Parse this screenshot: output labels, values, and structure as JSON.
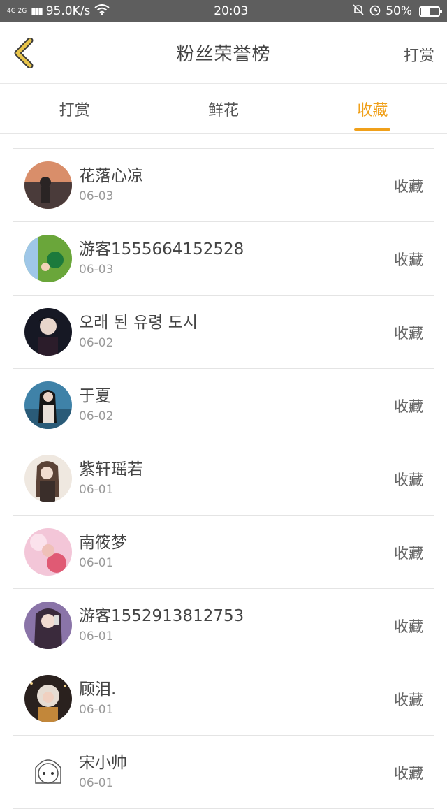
{
  "status_bar": {
    "network": "4G 2G",
    "speed": "95.0K/s",
    "time": "20:03",
    "battery": "50%",
    "battery_level": 0.5
  },
  "header": {
    "title": "粉丝荣誉榜",
    "right_label": "打赏"
  },
  "tabs": [
    {
      "label": "打赏"
    },
    {
      "label": "鲜花"
    },
    {
      "label": "收藏"
    }
  ],
  "active_tab": "收藏",
  "rows": [
    {
      "name": "花落心凉",
      "date": "06-03",
      "action": "收藏"
    },
    {
      "name": "游客15556641​52528",
      "date": "06-03",
      "action": "收藏"
    },
    {
      "name": "오래 된 유령 도시",
      "date": "06-02",
      "action": "收藏"
    },
    {
      "name": "于夏",
      "date": "06-02",
      "action": "收藏"
    },
    {
      "name": "紫轩瑶若",
      "date": "06-01",
      "action": "收藏"
    },
    {
      "name": "南筱梦",
      "date": "06-01",
      "action": "收藏"
    },
    {
      "name": "游客15529138127​53",
      "date": "06-01",
      "action": "收藏"
    },
    {
      "name": "顾泪.",
      "date": "06-01",
      "action": "收藏"
    },
    {
      "name": "宋小帅",
      "date": "06-01",
      "action": "收藏"
    }
  ],
  "colors": {
    "accent": "#f0a01a",
    "back_icon": "#e8c44a"
  }
}
